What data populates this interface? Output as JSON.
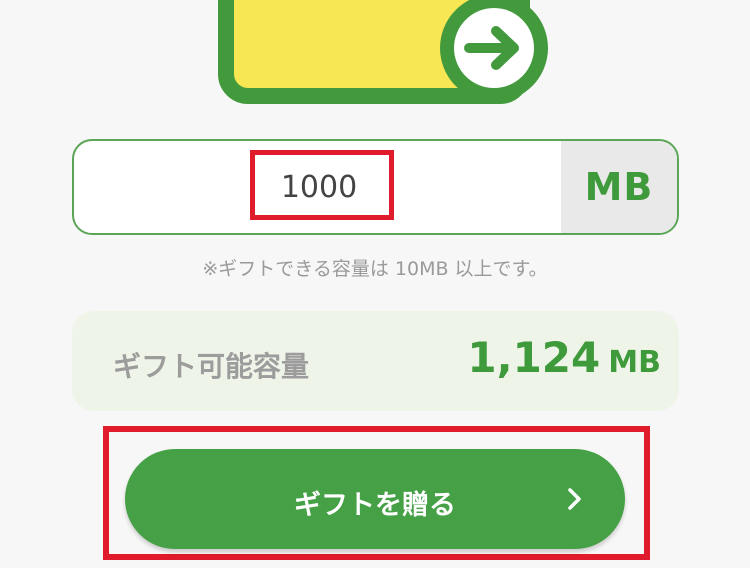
{
  "amount_input": {
    "value": "1000",
    "unit": "MB"
  },
  "note": "※ギフトできる容量は 10MB 以上です。",
  "available": {
    "label": "ギフト可能容量",
    "value": "1,124",
    "unit": "MB"
  },
  "gift_button": {
    "label": "ギフトを贈る"
  },
  "icons": {
    "illustration": "gift-card-arrow-icon",
    "arrow": "arrow-right-icon",
    "chevron": "chevron-right-icon"
  },
  "colors": {
    "brand_green": "#439a3d",
    "card_yellow": "#f6e753",
    "highlight_red": "#e01b2b",
    "button_green": "#45a046"
  }
}
